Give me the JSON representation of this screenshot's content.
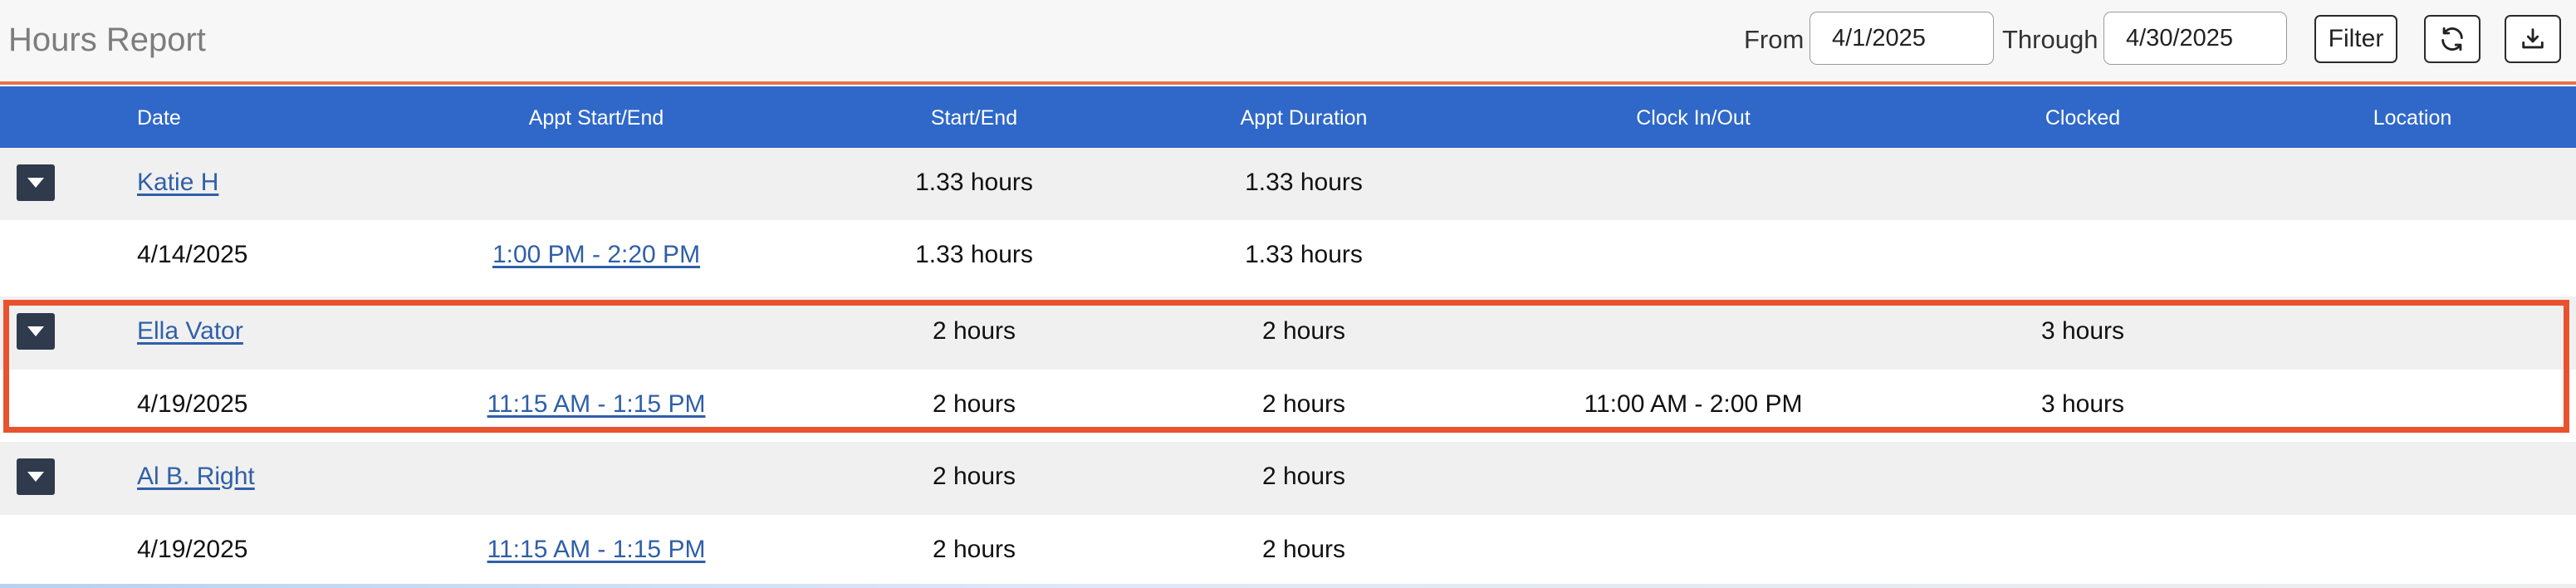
{
  "header": {
    "title": "Hours Report",
    "from_label": "From",
    "from_value": "4/1/2025",
    "through_label": "Through",
    "through_value": "4/30/2025",
    "filter_label": "Filter"
  },
  "icons": {
    "refresh": "refresh-icon",
    "download": "download-icon",
    "expand": "chevron-down-icon"
  },
  "colors": {
    "header_bg": "#2f68c9",
    "accent": "#e5704a",
    "highlight": "#e8532f",
    "link": "#2f5fa8"
  },
  "columns": [
    "Date",
    "Appt Start/End",
    "Start/End",
    "Appt Duration",
    "Clock In/Out",
    "Clocked",
    "Location"
  ],
  "groups": [
    {
      "name": "Katie H",
      "start_end": "1.33 hours",
      "appt_duration": "1.33 hours",
      "clocked": "",
      "detail": {
        "date": "4/14/2025",
        "appt_start_end": "1:00 PM - 2:20 PM",
        "start_end": "1.33 hours",
        "appt_duration": "1.33 hours",
        "clock_in_out": "",
        "clocked": ""
      }
    },
    {
      "name": "Ella Vator",
      "start_end": "2 hours",
      "appt_duration": "2 hours",
      "clocked": "3 hours",
      "detail": {
        "date": "4/19/2025",
        "appt_start_end": "11:15 AM - 1:15 PM",
        "start_end": "2 hours",
        "appt_duration": "2 hours",
        "clock_in_out": "11:00 AM - 2:00 PM",
        "clocked": "3 hours"
      }
    },
    {
      "name": "Al B. Right",
      "start_end": "2 hours",
      "appt_duration": "2 hours",
      "clocked": "",
      "detail": {
        "date": "4/19/2025",
        "appt_start_end": "11:15 AM - 1:15 PM",
        "start_end": "2 hours",
        "appt_duration": "2 hours",
        "clock_in_out": "",
        "clocked": ""
      }
    }
  ]
}
